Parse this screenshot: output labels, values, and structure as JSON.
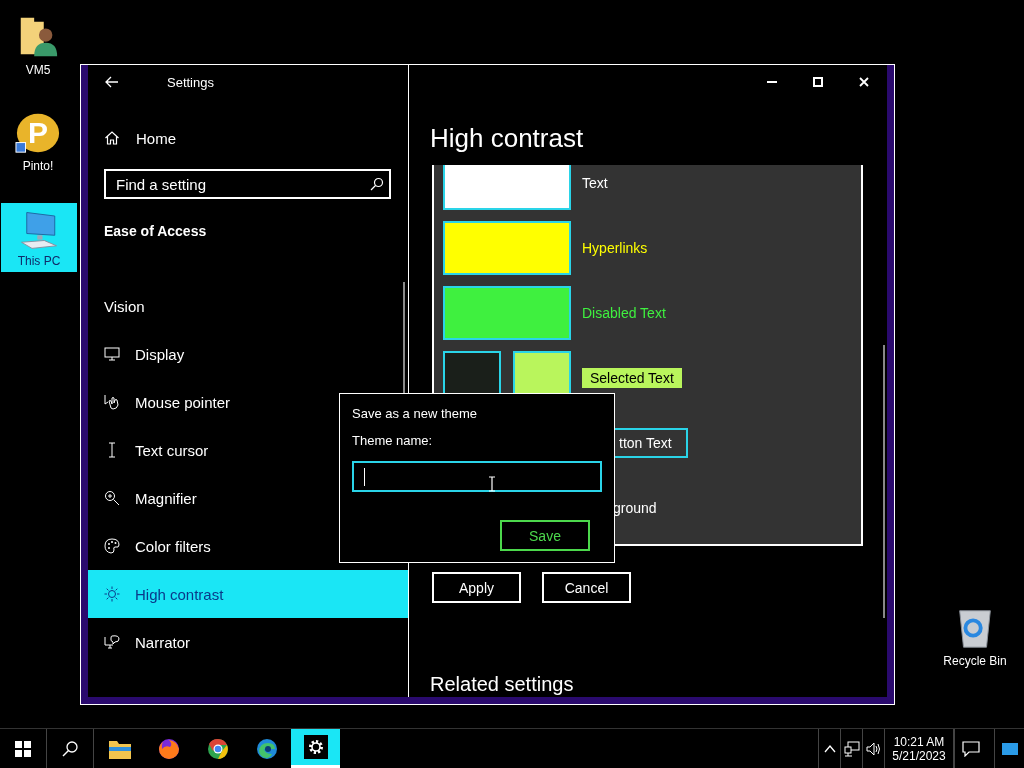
{
  "desktop_icons": [
    {
      "kind": "user-folder",
      "label": "VM5",
      "selected": false
    },
    {
      "kind": "app",
      "badge": "P",
      "label": "Pinto!",
      "selected": false
    },
    {
      "kind": "computer",
      "label": "This PC",
      "selected": true
    },
    {
      "kind": "bin",
      "label": "Recycle Bin",
      "selected": false
    }
  ],
  "window": {
    "title": "Settings"
  },
  "sidebar": {
    "home": "Home",
    "search": {
      "placeholder": "Find a setting"
    },
    "section": "Ease of Access",
    "group": "Vision",
    "items": [
      {
        "kind": "display",
        "label": "Display",
        "selected": false
      },
      {
        "kind": "pointer",
        "label": "Mouse pointer",
        "selected": false
      },
      {
        "kind": "cursor",
        "label": "Text cursor",
        "selected": false
      },
      {
        "kind": "magnifier",
        "label": "Magnifier",
        "selected": false
      },
      {
        "kind": "palette",
        "label": "Color filters",
        "selected": false
      },
      {
        "kind": "sun",
        "label": "High contrast",
        "selected": true
      },
      {
        "kind": "narrator",
        "label": "Narrator",
        "selected": false
      }
    ]
  },
  "page": {
    "title": "High contrast",
    "colors": [
      {
        "kind": "swatch",
        "label": "Text",
        "color": "#ffffff"
      },
      {
        "kind": "swatch",
        "label": "Hyperlinks",
        "color": "#ffff00"
      },
      {
        "kind": "swatch",
        "label": "Disabled Text",
        "color": "#3ff03f"
      },
      {
        "kind": "pair",
        "label": "Selected Text",
        "swatches": [
          {
            "color": "#1a1f1a"
          },
          {
            "color": "#b9f55c"
          }
        ]
      },
      {
        "kind": "button",
        "label": "tton Text"
      },
      {
        "kind": "plain",
        "label": "ground"
      }
    ],
    "buttons": [
      "Apply",
      "Cancel"
    ],
    "related": "Related settings"
  },
  "dialog": {
    "title": "Save as a new theme",
    "label": "Theme name:",
    "button": "Save"
  },
  "taskbar": {
    "apps": [
      {
        "kind": "folder",
        "selected": false
      },
      {
        "kind": "firefox",
        "selected": false
      },
      {
        "kind": "chrome",
        "selected": false
      },
      {
        "kind": "edge",
        "selected": false
      },
      {
        "kind": "settings",
        "selected": true
      }
    ],
    "time": "10:21 AM",
    "date": "5/21/2023"
  }
}
